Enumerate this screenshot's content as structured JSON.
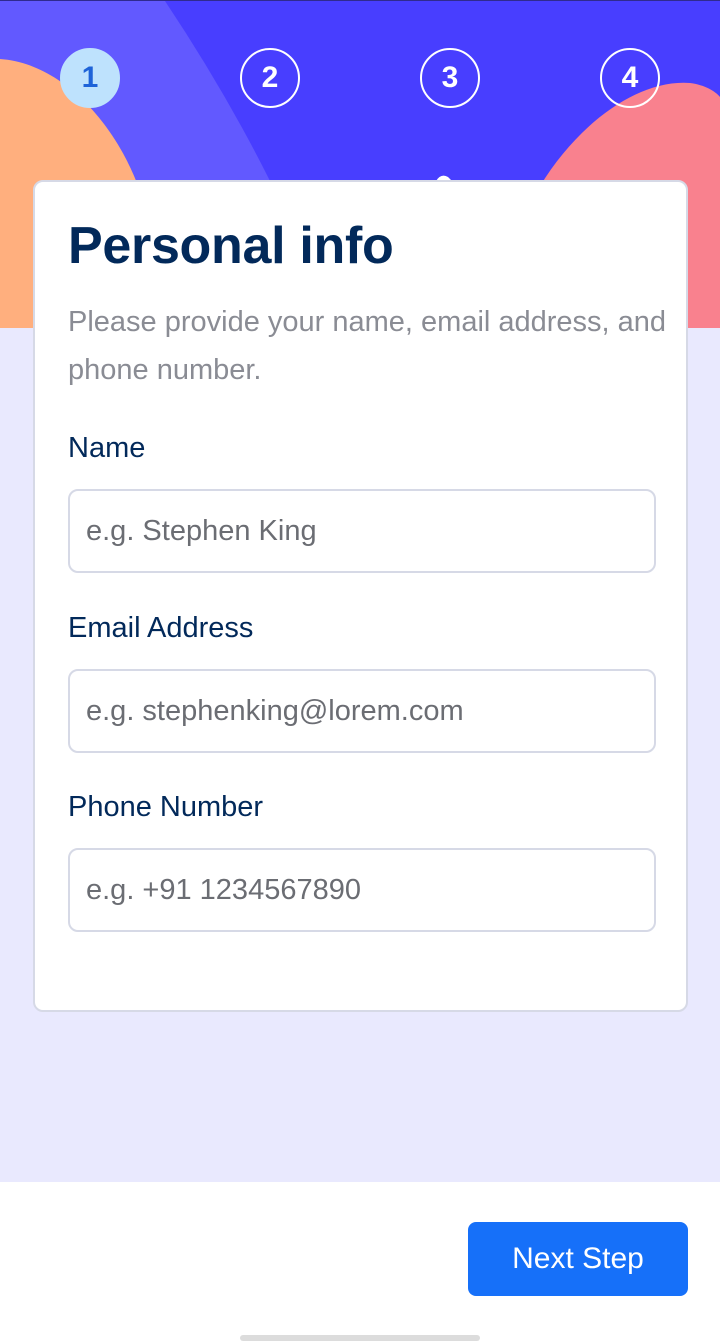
{
  "colors": {
    "hero_bg": "#483eff",
    "accent_orange": "#ffaf7e",
    "accent_pink": "#f9818e",
    "accent_violet": "#6259ff",
    "title": "#02295a",
    "button": "#1670f9",
    "page_bg": "#e9e9fe"
  },
  "steps": [
    {
      "number": "1",
      "active": true
    },
    {
      "number": "2",
      "active": false
    },
    {
      "number": "3",
      "active": false
    },
    {
      "number": "4",
      "active": false
    }
  ],
  "form": {
    "title": "Personal info",
    "description": "Please provide your name, email address, and phone number.",
    "name": {
      "label": "Name",
      "placeholder": "e.g. Stephen King",
      "value": ""
    },
    "email": {
      "label": "Email Address",
      "placeholder": "e.g. stephenking@lorem.com",
      "value": ""
    },
    "phone": {
      "label": "Phone Number",
      "placeholder": "e.g. +91 1234567890",
      "value": ""
    }
  },
  "footer": {
    "next_label": "Next Step"
  }
}
